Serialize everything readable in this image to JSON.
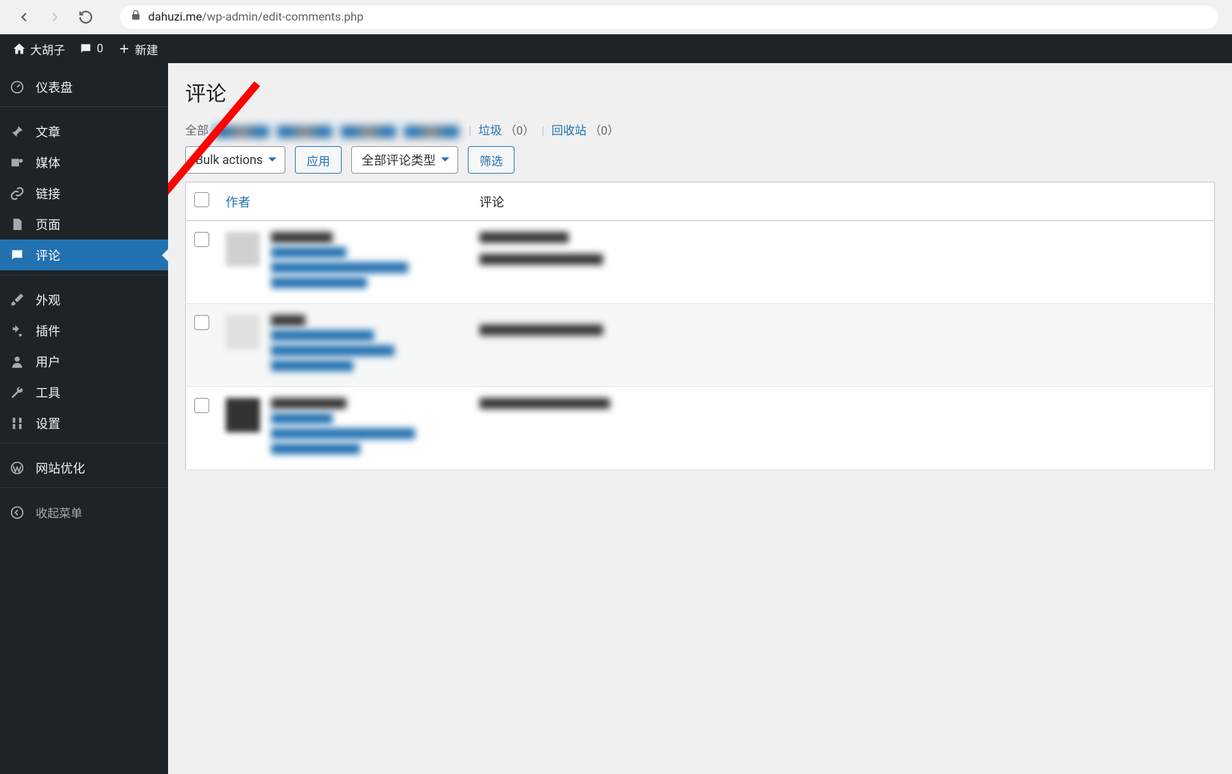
{
  "browser": {
    "domain": "dahuzi.me",
    "path": "/wp-admin/edit-comments.php"
  },
  "adminbar": {
    "site_name": "大胡子",
    "comment_count": "0",
    "new_label": "新建"
  },
  "sidebar": {
    "items": [
      {
        "id": "dashboard",
        "label": "仪表盘"
      },
      {
        "id": "posts",
        "label": "文章"
      },
      {
        "id": "media",
        "label": "媒体"
      },
      {
        "id": "links",
        "label": "链接"
      },
      {
        "id": "pages",
        "label": "页面"
      },
      {
        "id": "comments",
        "label": "评论"
      },
      {
        "id": "appearance",
        "label": "外观"
      },
      {
        "id": "plugins",
        "label": "插件"
      },
      {
        "id": "users",
        "label": "用户"
      },
      {
        "id": "tools",
        "label": "工具"
      },
      {
        "id": "settings",
        "label": "设置"
      },
      {
        "id": "seo",
        "label": "网站优化"
      }
    ],
    "collapse_label": "收起菜单"
  },
  "page": {
    "title": "评论",
    "filters": {
      "all_prefix": "全部",
      "spam": "垃圾",
      "spam_count": "（0）",
      "trash": "回收站",
      "trash_count": "（0）"
    },
    "bulk_actions": "Bulk actions",
    "apply": "应用",
    "comment_types": "全部评论类型",
    "filter": "筛选",
    "columns": {
      "author": "作者",
      "comment": "评论"
    }
  }
}
